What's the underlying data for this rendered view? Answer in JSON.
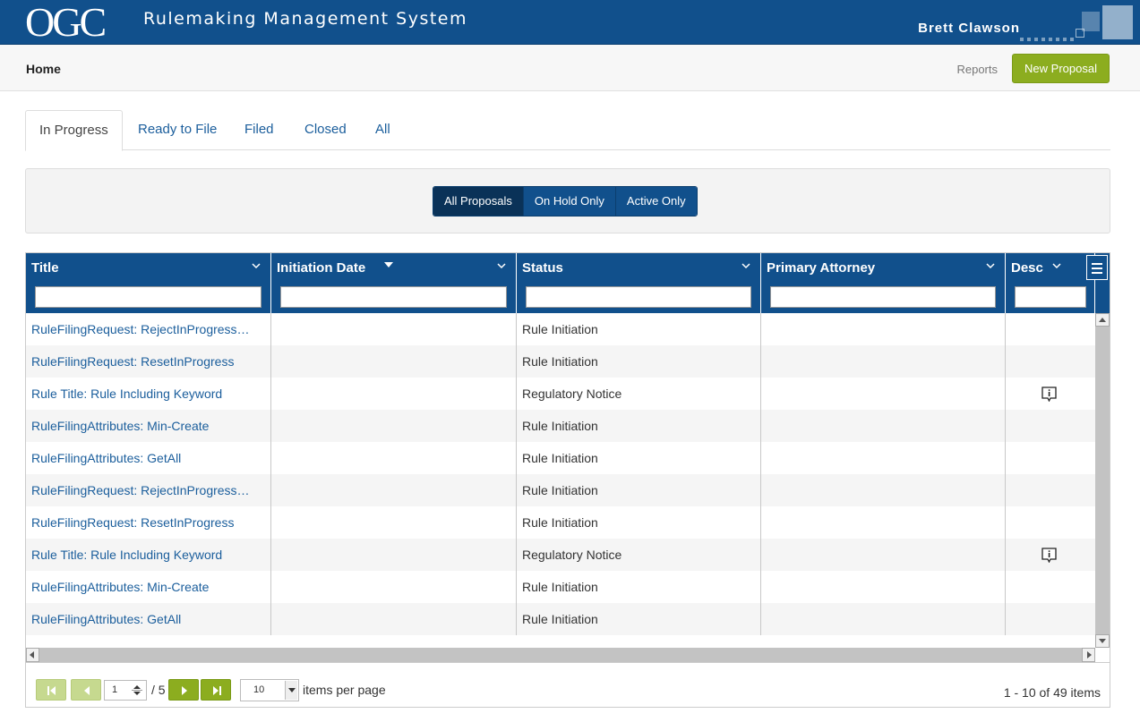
{
  "header": {
    "logo_text": "OGC",
    "app_title": "Rulemaking Management System",
    "user_name": "Brett Clawson"
  },
  "subheader": {
    "home_label": "Home",
    "reports_label": "Reports",
    "new_proposal_label": "New Proposal"
  },
  "tabs": [
    {
      "label": "In Progress",
      "active": true
    },
    {
      "label": "Ready to File",
      "active": false
    },
    {
      "label": "Filed",
      "active": false
    },
    {
      "label": "Closed",
      "active": false
    },
    {
      "label": "All",
      "active": false
    }
  ],
  "filters": [
    {
      "label": "All Proposals",
      "active": true
    },
    {
      "label": "On Hold Only",
      "active": false
    },
    {
      "label": "Active Only",
      "active": false
    }
  ],
  "grid": {
    "columns": [
      "Title",
      "Initiation Date",
      "Status",
      "Primary Attorney",
      "Desc"
    ],
    "sorted_column": "Initiation Date",
    "rows": [
      {
        "title": "RuleFilingRequest: RejectInProgress…",
        "initiation_date": "",
        "status": "Rule Initiation",
        "attorney": "",
        "desc_icon": false
      },
      {
        "title": "RuleFilingRequest: ResetInProgress",
        "initiation_date": "",
        "status": "Rule Initiation",
        "attorney": "",
        "desc_icon": false
      },
      {
        "title": "Rule Title: Rule Including Keyword",
        "initiation_date": "",
        "status": "Regulatory Notice",
        "attorney": "",
        "desc_icon": true
      },
      {
        "title": "RuleFilingAttributes: Min-Create",
        "initiation_date": "",
        "status": "Rule Initiation",
        "attorney": "",
        "desc_icon": false
      },
      {
        "title": "RuleFilingAttributes: GetAll",
        "initiation_date": "",
        "status": "Rule Initiation",
        "attorney": "",
        "desc_icon": false
      },
      {
        "title": "RuleFilingRequest: RejectInProgress…",
        "initiation_date": "",
        "status": "Rule Initiation",
        "attorney": "",
        "desc_icon": false
      },
      {
        "title": "RuleFilingRequest: ResetInProgress",
        "initiation_date": "",
        "status": "Rule Initiation",
        "attorney": "",
        "desc_icon": false
      },
      {
        "title": "Rule Title: Rule Including Keyword",
        "initiation_date": "",
        "status": "Regulatory Notice",
        "attorney": "",
        "desc_icon": true
      },
      {
        "title": "RuleFilingAttributes: Min-Create",
        "initiation_date": "",
        "status": "Rule Initiation",
        "attorney": "",
        "desc_icon": false
      },
      {
        "title": "RuleFilingAttributes: GetAll",
        "initiation_date": "",
        "status": "Rule Initiation",
        "attorney": "",
        "desc_icon": false
      }
    ]
  },
  "pager": {
    "current_page": "1",
    "total_pages": "/ 5",
    "page_size": "10",
    "items_per_page_label": "items per page",
    "range_text": "1 - 10 of 49 items"
  },
  "colors": {
    "brand_blue": "#11508c",
    "accent_green": "#8cad1f",
    "link_blue": "#1b5e9c"
  }
}
